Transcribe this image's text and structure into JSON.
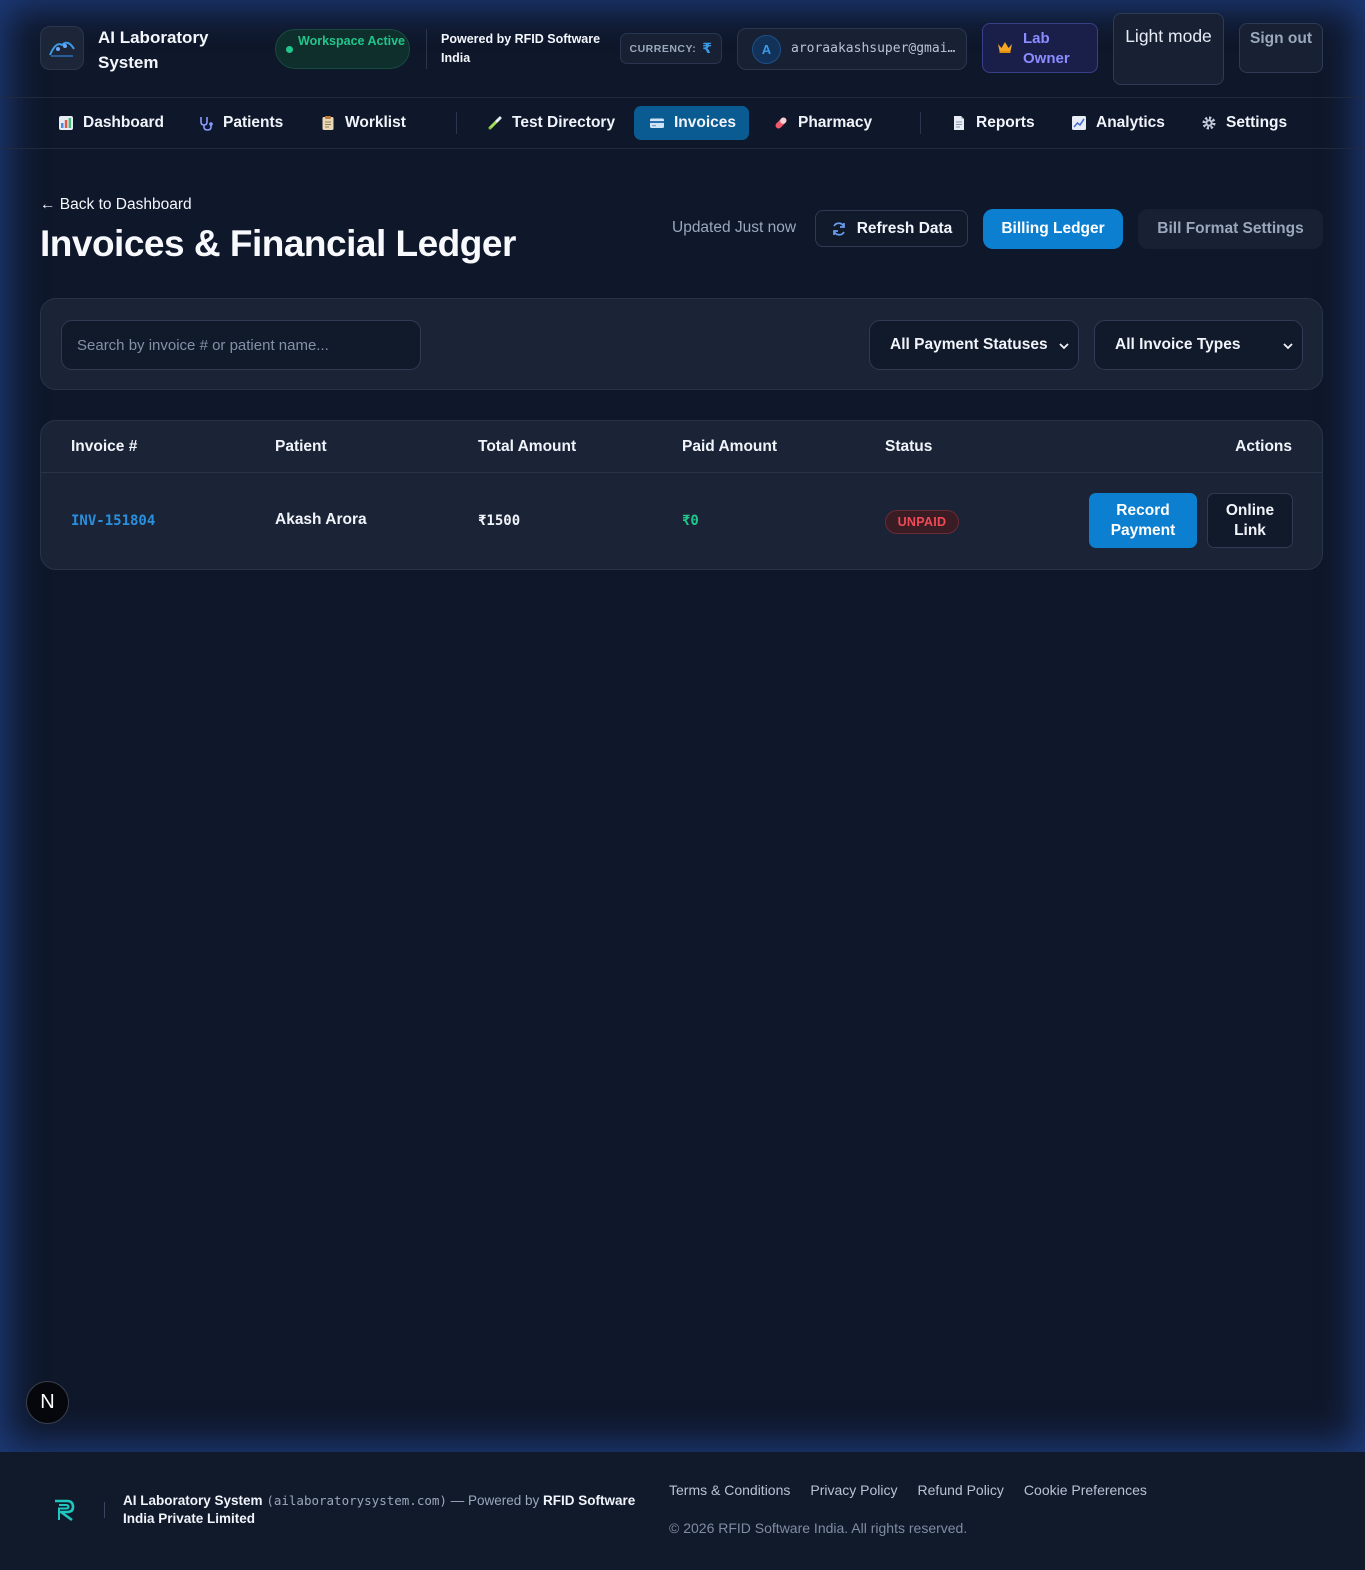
{
  "header": {
    "brand": "AI Laboratory System",
    "workspace_status": "Workspace Active",
    "powered_by": "Powered by RFID Software India",
    "currency_label": "CURRENCY:",
    "currency_symbol": "₹",
    "user_initial": "A",
    "user_email": "aroraakashsuper@gmai…",
    "role": "Lab Owner",
    "theme_toggle": "Light mode",
    "sign_out": "Sign out"
  },
  "nav": {
    "items": [
      {
        "label": "Dashboard",
        "icon": "bar-chart-icon"
      },
      {
        "label": "Patients",
        "icon": "stethoscope-icon"
      },
      {
        "label": "Worklist",
        "icon": "clipboard-icon"
      },
      {
        "label": "Test Directory",
        "icon": "pipette-icon"
      },
      {
        "label": "Invoices",
        "icon": "credit-card-icon",
        "active": true
      },
      {
        "label": "Pharmacy",
        "icon": "pill-icon"
      },
      {
        "label": "Reports",
        "icon": "document-icon"
      },
      {
        "label": "Analytics",
        "icon": "line-chart-icon"
      },
      {
        "label": "Settings",
        "icon": "gear-icon"
      }
    ]
  },
  "page": {
    "back_link": "← Back to Dashboard",
    "title": "Invoices & Financial Ledger",
    "updated": "Updated Just now",
    "refresh": "Refresh Data",
    "billing_ledger": "Billing Ledger",
    "bill_format_settings": "Bill Format Settings"
  },
  "filters": {
    "search_placeholder": "Search by invoice # or patient name...",
    "payment_status": "All Payment Statuses",
    "invoice_type": "All Invoice Types"
  },
  "table": {
    "columns": [
      "Invoice #",
      "Patient",
      "Total Amount",
      "Paid Amount",
      "Status",
      "Actions"
    ],
    "rows": [
      {
        "invoice": "INV-151804",
        "patient": "Akash Arora",
        "total": "₹1500",
        "paid": "₹0",
        "status": "UNPAID",
        "actions": [
          "Record Payment",
          "Online Link"
        ]
      }
    ]
  },
  "floating_badge": "N",
  "footer": {
    "brand": "AI Laboratory System",
    "domain": "(ailaboratorysystem.com)",
    "powered_prefix": "— Powered by",
    "company": "RFID Software India Private Limited",
    "links": [
      "Terms & Conditions",
      "Privacy Policy",
      "Refund Policy",
      "Cookie Preferences"
    ],
    "copyright": "© 2026 RFID Software India. All rights reserved."
  },
  "colors": {
    "background": "#0f172a",
    "accent": "#0c7fd0",
    "success": "#22c58b",
    "danger": "#ef4a55"
  }
}
